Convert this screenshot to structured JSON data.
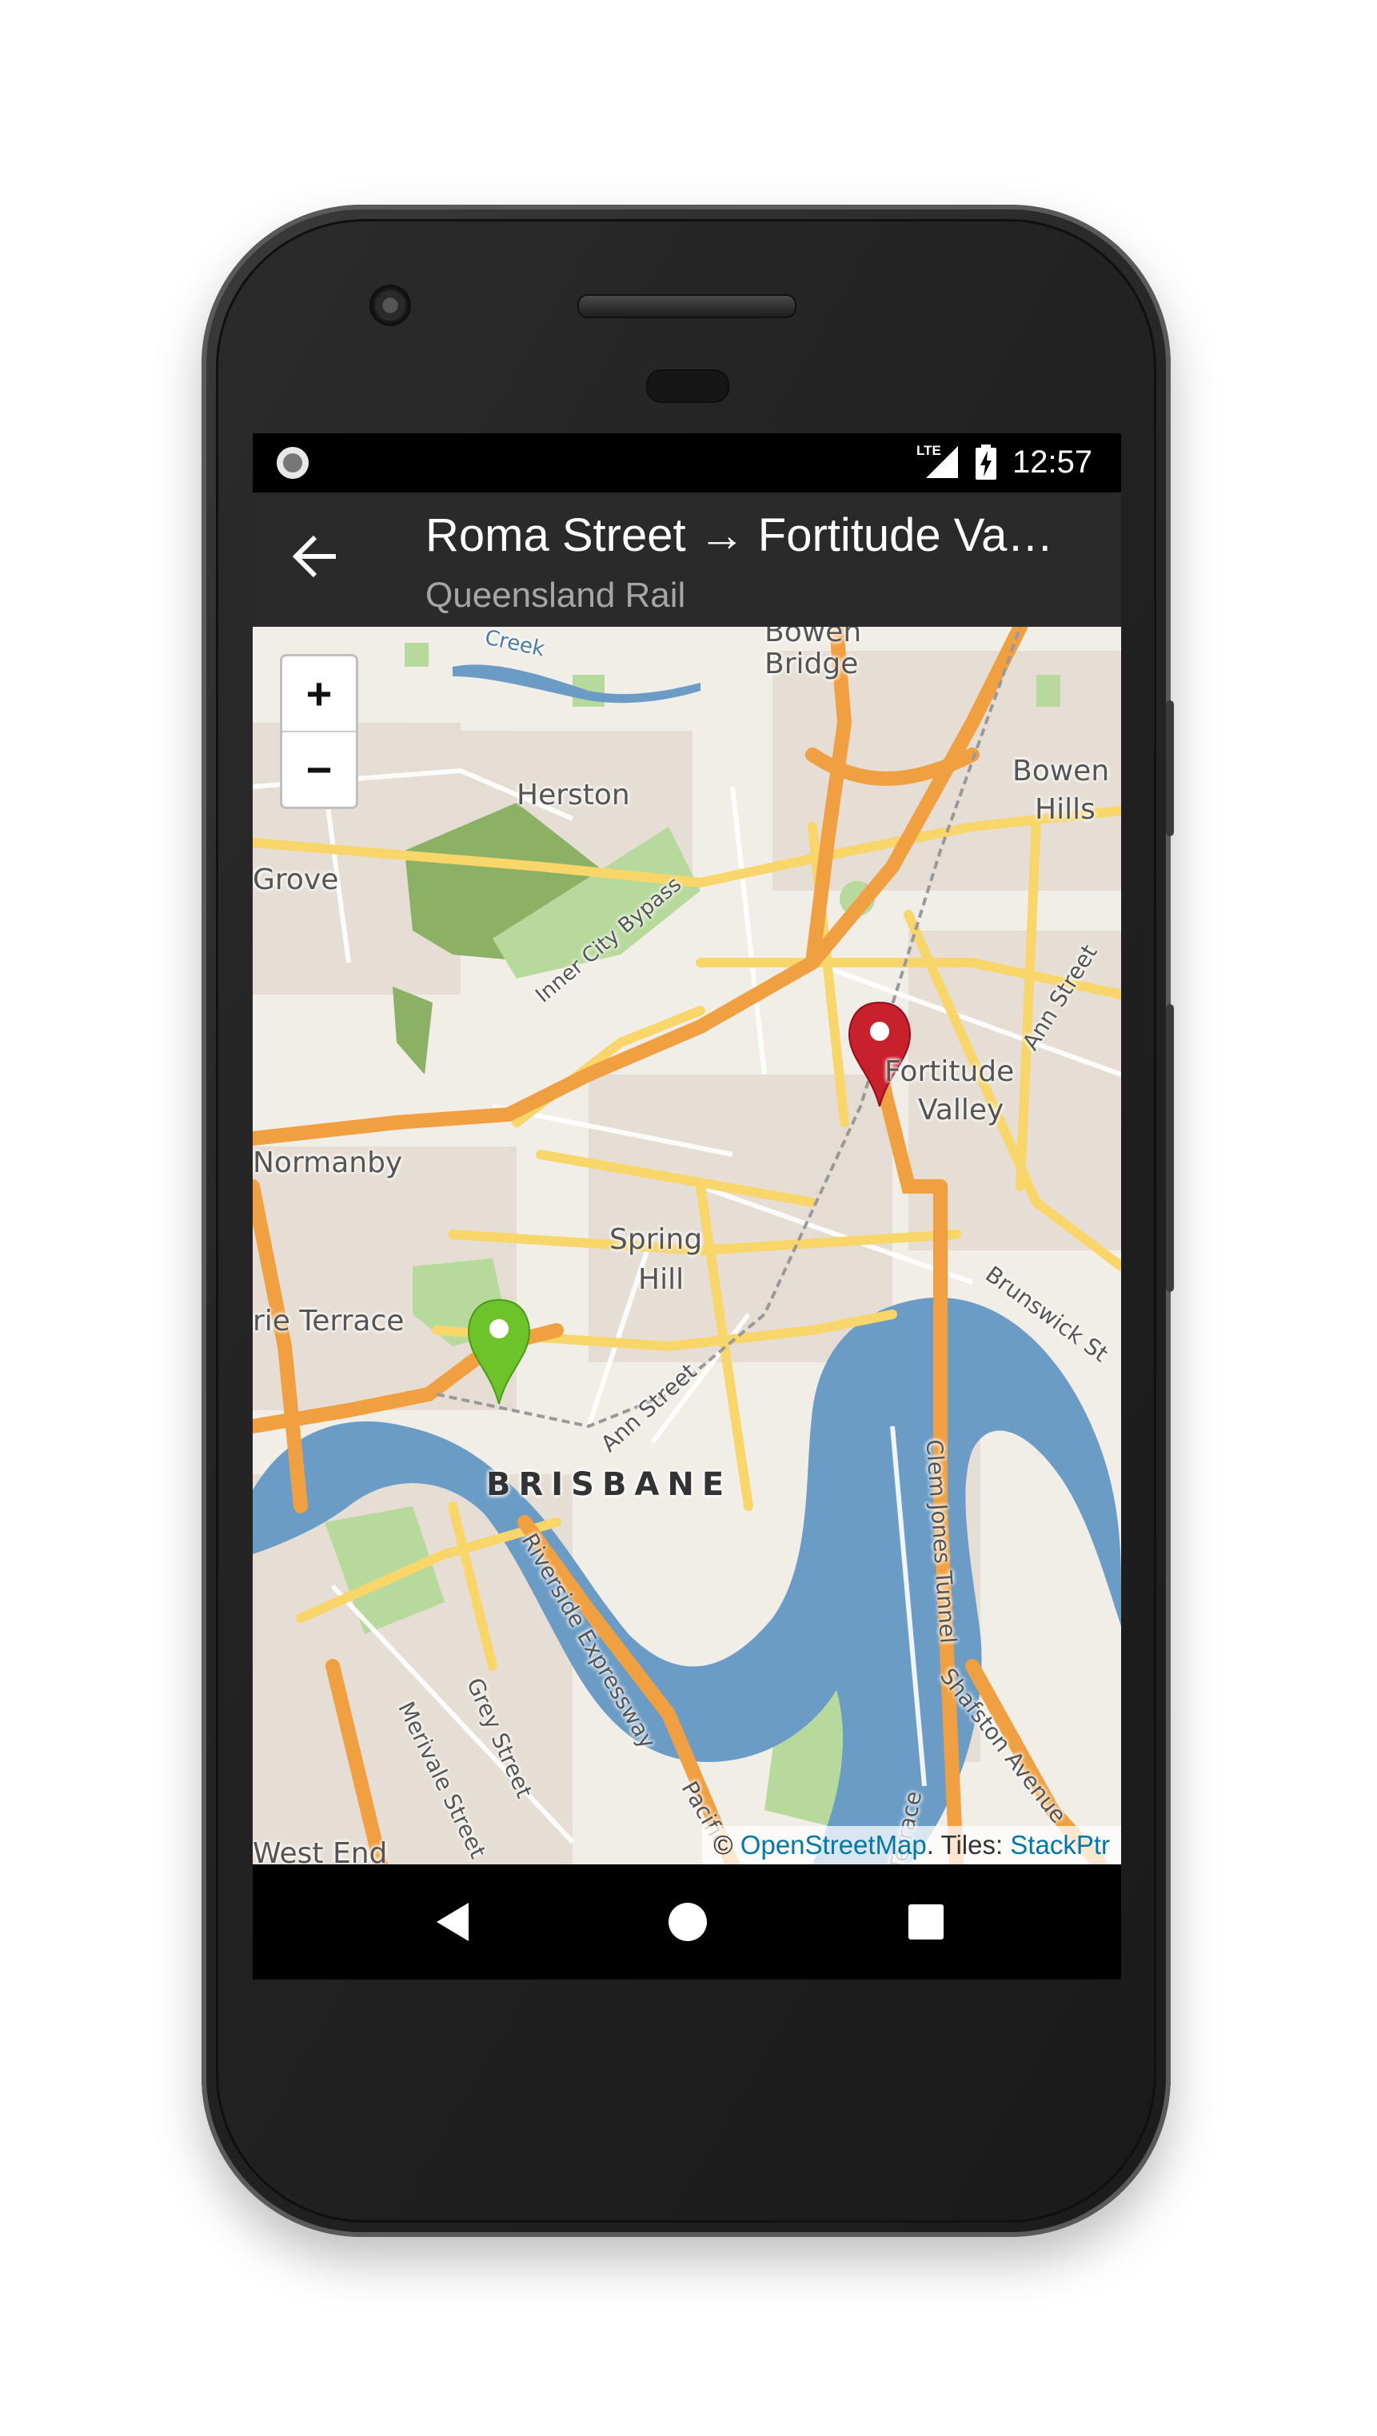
{
  "status_bar": {
    "network_label": "LTE",
    "time": "12:57",
    "icons": [
      "notification-dot-icon",
      "signal-icon",
      "battery-charging-icon"
    ]
  },
  "app_bar": {
    "back_icon": "arrow-back-icon",
    "title": "Roma Street → Fortitude Va…",
    "subtitle": "Queensland Rail"
  },
  "map": {
    "zoom_in_label": "+",
    "zoom_out_label": "−",
    "labels": {
      "bowen_bridge_1": "Bowen",
      "bowen_bridge_2": "Bridge",
      "creek": "Creek",
      "herston": "Herston",
      "bowen_hills_1": "Bowen",
      "bowen_hills_2": "Hills",
      "grove": "Grove",
      "inner_city_bypass": "Inner City Bypass",
      "ann_street_ne": "Ann Street",
      "fortitude_1": "Fortitude",
      "fortitude_2": "Valley",
      "normanby": "Normanby",
      "spring_hill_1": "Spring",
      "spring_hill_2": "Hill",
      "brunswick": "Brunswick St",
      "terrace": "rie Terrace",
      "ann_street": "Ann Street",
      "brisbane": "BRISBANE",
      "clem_jones": "Clem Jones Tunnel",
      "riverside": "Riverside Expressway",
      "merivale": "Merivale Street",
      "grey": "Grey Street",
      "shafston": "Shafston Avenue",
      "pacific": "Pacific",
      "terrace_2": "Terrace",
      "west_end": "West End"
    },
    "markers": {
      "origin_color": "#6cc42a",
      "destination_color": "#c8202c"
    },
    "attribution": {
      "copyright": "©",
      "osm_link": "OpenStreetMap",
      "tiles_text": ". Tiles:",
      "tiles_link": "StackPtr"
    }
  },
  "nav_bar": {
    "icons": [
      "back-triangle-icon",
      "home-circle-icon",
      "recents-square-icon"
    ]
  },
  "colors": {
    "app_bar": "#2a2a2a",
    "water": "#6a9cc6",
    "motorway": "#f0a040",
    "primary_road": "#f8d66a",
    "park": "#8cb064"
  }
}
